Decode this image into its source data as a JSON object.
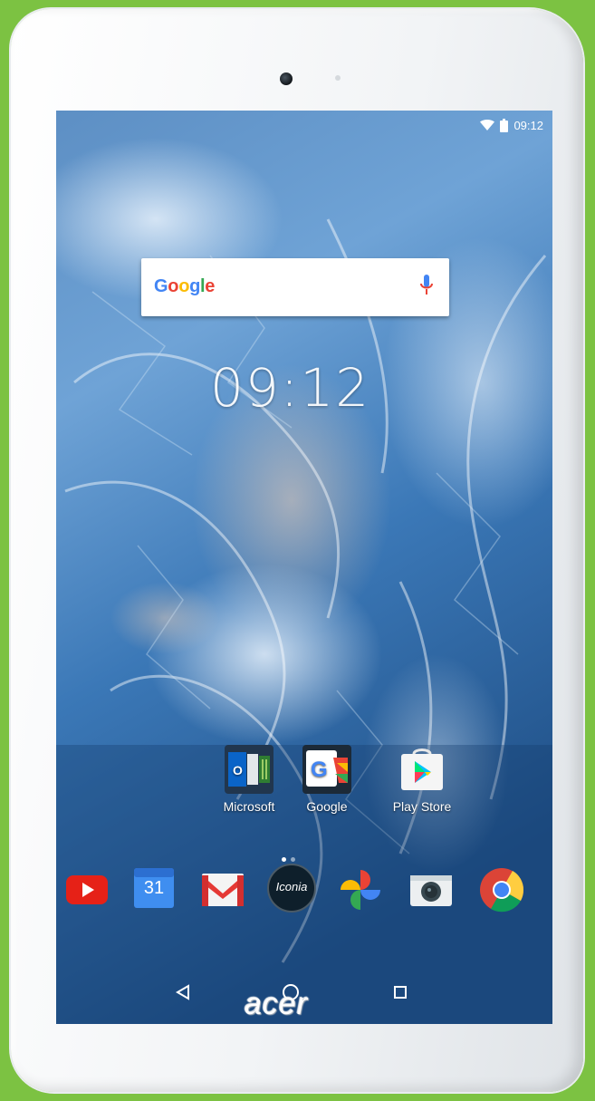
{
  "status_bar": {
    "time": "09:12",
    "icons": [
      "wifi-icon",
      "battery-icon"
    ]
  },
  "search": {
    "logo_letters": [
      "G",
      "o",
      "o",
      "g",
      "l",
      "e"
    ],
    "icon": "microphone-icon"
  },
  "clock": {
    "time": "09:12"
  },
  "home_apps": [
    {
      "label": "Microsoft",
      "icon": "microsoft-folder-icon"
    },
    {
      "label": "Google",
      "icon": "google-folder-icon"
    },
    {
      "label": "Play Store",
      "icon": "play-store-icon"
    }
  ],
  "page_indicator": {
    "pages": 2,
    "current": 1
  },
  "dock": [
    {
      "name": "youtube",
      "icon": "youtube-icon"
    },
    {
      "name": "calendar",
      "icon": "calendar-icon",
      "text": "31"
    },
    {
      "name": "gmail",
      "icon": "gmail-icon"
    },
    {
      "name": "iconia",
      "icon": "iconia-icon",
      "text": "Iconia"
    },
    {
      "name": "photos",
      "icon": "photos-icon"
    },
    {
      "name": "camera",
      "icon": "camera-icon"
    },
    {
      "name": "chrome",
      "icon": "chrome-icon"
    }
  ],
  "navigation": [
    "back-icon",
    "home-icon",
    "recents-icon"
  ],
  "device": {
    "brand": "acer"
  },
  "colors": {
    "background": "#7cc242",
    "bezel": "#f4f6f8",
    "wallpaper": "#2e6aa6"
  }
}
